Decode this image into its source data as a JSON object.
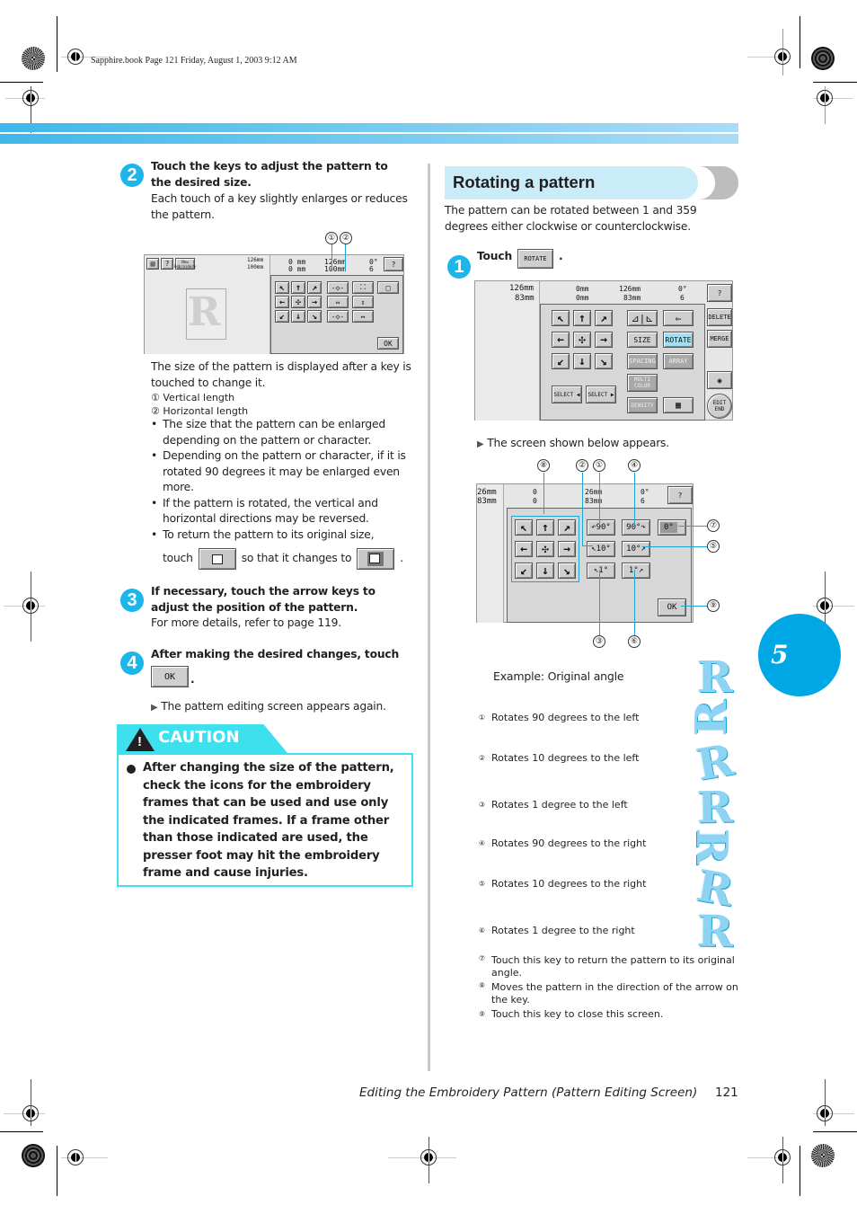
{
  "header": {
    "file_info": "Sapphire.book  Page 121  Friday, August 1, 2003  9:12 AM"
  },
  "left": {
    "step2": {
      "number": "2",
      "title": "Touch the keys to adjust the pattern to the desired size.",
      "body": "Each touch of a key slightly enlarges or reduces the pattern."
    },
    "size_screen": {
      "callouts": [
        "①",
        "②"
      ],
      "preview_size_v": "126mm",
      "preview_size_h": "100mm",
      "new_embroidery_label": "New Embroidery",
      "pos_v": "0  mm",
      "pos_h": "0  mm",
      "size_v": "126mm",
      "size_h": "100mm",
      "angle": "0°",
      "colors": "6",
      "arrow_keys": [
        "↖",
        "↑",
        "↗",
        "←",
        "✣",
        "→",
        "↙",
        "↓",
        "↘"
      ],
      "ok_label": "OK"
    },
    "size_note": "The size of the pattern is displayed after a key is touched to change it.",
    "legend": [
      {
        "num": "①",
        "text": "Vertical length"
      },
      {
        "num": "②",
        "text": "Horizontal length"
      }
    ],
    "bullets": [
      "The size that the pattern can be enlarged depending on the pattern or character.",
      "Depending on the pattern or character, if it is rotated 90 degrees it may be enlarged even more.",
      "If the pattern is rotated, the vertical and horizontal directions may be reversed.",
      "To return the pattern to its original size,"
    ],
    "bullet4_touch": "touch",
    "bullet4_mid": "so that it changes to",
    "bullet4_end": ".",
    "step3": {
      "number": "3",
      "title": "If necessary, touch the arrow keys to adjust the position of the pattern.",
      "body": "For more details, refer to page 119."
    },
    "step4": {
      "number": "4",
      "title": "After making the desired changes, touch",
      "ok_label": "OK",
      "end": ".",
      "result": "The pattern editing screen appears again."
    },
    "caution": {
      "label": "CAUTION",
      "text": "After changing the size of the pattern, check the icons for the embroidery frames that can be used and use only the indicated frames. If a frame other than those indicated are used, the presser foot may hit the embroidery frame and cause injuries."
    }
  },
  "right": {
    "section_title": "Rotating a pattern",
    "intro": "The pattern can be rotated between 1 and 359 degrees either clockwise or counterclockwise.",
    "step1": {
      "number": "1",
      "touch": "Touch",
      "rotate_label": "ROTATE",
      "end": "."
    },
    "edit_screen": {
      "size_v": "126mm",
      "size_h": "83mm",
      "pos_v": "0mm",
      "pos_h": "0mm",
      "size_v2": "126mm",
      "size_h2": "83mm",
      "angle": "0°",
      "colors": "6",
      "arrow_keys": [
        "↖",
        "↑",
        "↗",
        "←",
        "✣",
        "→",
        "↙",
        "↓",
        "↘"
      ],
      "keys": {
        "size": "SIZE",
        "rotate": "ROTATE",
        "spacing": "SPACING",
        "array": "ARRAY",
        "multi_color": "MULTI COLOR",
        "density": "DENSITY",
        "select_prev": "SELECT ◀",
        "select_next": "SELECT ▶",
        "delete": "DELETE",
        "merge": "MERGE",
        "edit_end": "EDIT END"
      }
    },
    "screen_appears": "The screen shown below appears.",
    "rotate_screen": {
      "size_v": "26mm",
      "size_h": "83mm",
      "pos_v": "0",
      "pos_h": "0",
      "size_v2": "26mm",
      "size_h2": "83mm",
      "angle": "0°",
      "colors": "6",
      "arrow_keys": [
        "↖",
        "↑",
        "↗",
        "←",
        "✣",
        "→",
        "↙",
        "↓",
        "↘"
      ],
      "rot_left_90": "↶90°",
      "rot_right_90": "90°↷",
      "rot_left_10": "↖10°",
      "rot_right_10": "10°↗",
      "rot_left_1": "↖1°",
      "rot_right_1": "1°↗",
      "reset_angle": "0°",
      "ok_label": "OK",
      "callouts": [
        "⑧",
        "②",
        "①",
        "④",
        "⑦",
        "⑤",
        "⑨",
        "③",
        "⑥"
      ]
    },
    "example_label": "Example: Original angle",
    "legend": [
      {
        "num": "①",
        "text": "Rotates 90 degrees to the left"
      },
      {
        "num": "②",
        "text": "Rotates 10 degrees to the left"
      },
      {
        "num": "③",
        "text": "Rotates 1 degree to the left"
      },
      {
        "num": "④",
        "text": "Rotates 90 degrees to the right"
      },
      {
        "num": "⑤",
        "text": "Rotates 10 degrees to the right"
      },
      {
        "num": "⑥",
        "text": "Rotates 1 degree to the right"
      },
      {
        "num": "⑦",
        "text": "Touch this key to return the pattern to its original angle."
      },
      {
        "num": "⑧",
        "text": "Moves the pattern in the direction of the arrow on the key."
      },
      {
        "num": "⑨",
        "text": "Touch this key to close this screen."
      }
    ],
    "example_letter": "R"
  },
  "chapter_tab": "5",
  "footer": {
    "title": "Editing the Embroidery Pattern (Pattern Editing Screen)",
    "page": "121"
  },
  "colors": {
    "accent": "#1cb6ea",
    "caution": "#3fe0ee",
    "chapter": "#00a7e5",
    "section_bg": "#c9ecf8"
  }
}
